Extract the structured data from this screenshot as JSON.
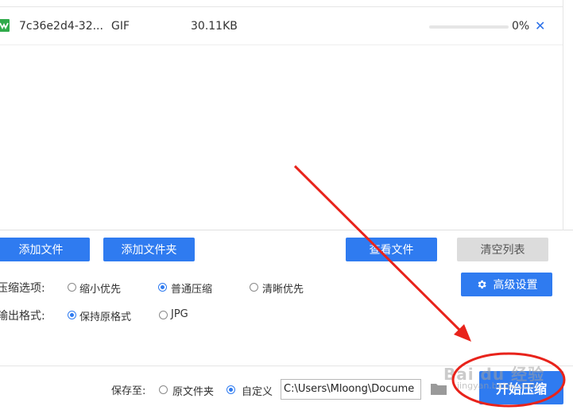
{
  "file_list": {
    "rows": [
      {
        "name": "7c36e2d4-32...",
        "type": "GIF",
        "size": "30.11KB",
        "progress": 0,
        "progress_text": "0%",
        "remove_glyph": "✕",
        "icon": "gif-file-icon"
      }
    ]
  },
  "toolbar": {
    "add_file": "添加文件",
    "add_folder": "添加文件夹",
    "view_file": "查看文件",
    "clear_list": "清空列表"
  },
  "compression": {
    "label": "压缩选项:",
    "options": [
      "缩小优先",
      "普通压缩",
      "清晰优先"
    ],
    "selected": "普通压缩"
  },
  "advanced": {
    "label": "高级设置",
    "icon": "gear-icon"
  },
  "output_format": {
    "label": "输出格式:",
    "options": [
      "保持原格式",
      "JPG"
    ],
    "selected": "保持原格式"
  },
  "save_to": {
    "label": "保存至:",
    "options": [
      "原文件夹",
      "自定义"
    ],
    "selected": "自定义",
    "path": "C:\\Users\\Mloong\\Docume"
  },
  "start_button": "开始压缩",
  "watermark": {
    "text": "Bai du 经验",
    "sub": "jingyan.baidu.com"
  },
  "colors": {
    "accent": "#2f7bf0",
    "annotation_red": "#e8231b",
    "disabled_gray": "#dcdcdc"
  }
}
